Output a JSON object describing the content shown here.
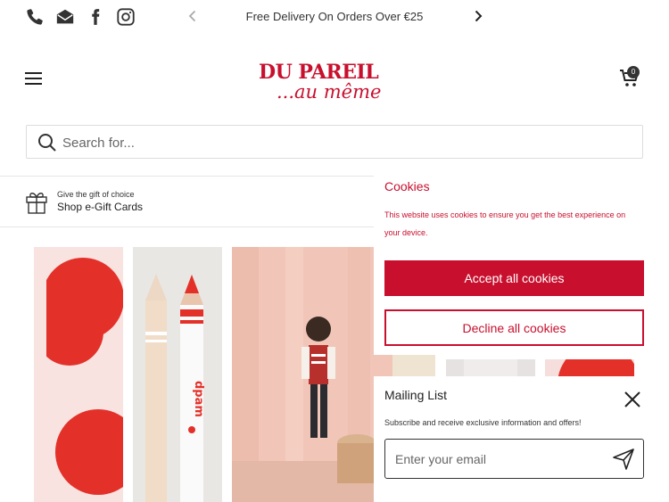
{
  "topbar": {
    "promo_text": "Free Delivery On Orders Over €25",
    "social_icons": [
      "phone-icon",
      "email-icon",
      "facebook-icon",
      "instagram-icon"
    ]
  },
  "header": {
    "logo_line1": "DU PAREIL",
    "logo_line2": "...au même",
    "cart_count": "0"
  },
  "search": {
    "placeholder": "Search for..."
  },
  "gift": {
    "small_text": "Give the gift of choice",
    "main_text": "Shop e-Gift Cards"
  },
  "hero": {
    "crayon_label": "dpam"
  },
  "cookies": {
    "title": "Cookies",
    "text": "This website uses cookies to ensure you get the best experience on your device.",
    "accept_label": "Accept all cookies",
    "decline_label": "Decline all cookies"
  },
  "mailing": {
    "title": "Mailing List",
    "text": "Subscribe and receive exclusive information and offers!",
    "email_placeholder": "Enter your email"
  },
  "colors": {
    "brand_red": "#c8102e",
    "hero_red": "#e3312a",
    "text_dark": "#333333"
  }
}
